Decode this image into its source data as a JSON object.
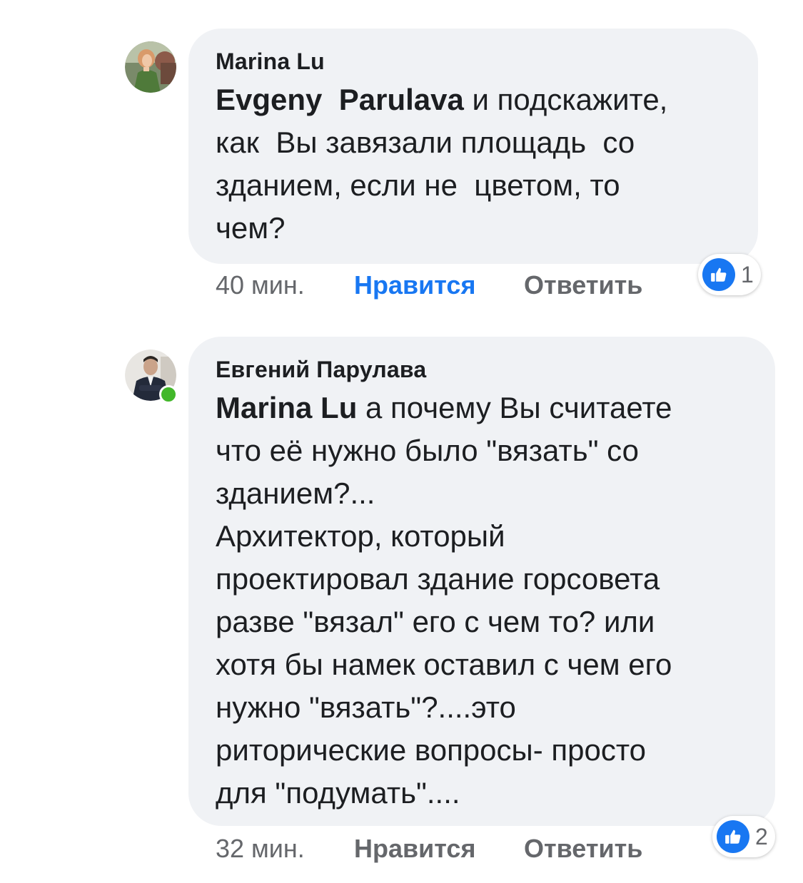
{
  "comments": [
    {
      "author": "Marina Lu",
      "mention": "Evgeny  Parulava",
      "text": " и подскажите,\nкак  Вы завязали площадь  со\nзданием, если не  цветом, то\nчем?",
      "time": "40 мин.",
      "like_label": "Нравится",
      "reply_label": "Ответить",
      "reactions": {
        "icon": "like-icon",
        "count": "1"
      }
    },
    {
      "author": "Евгений Парулава",
      "mention": "Marina Lu",
      "text": " а почему Вы считаете\nчто её нужно было \"вязать\" со\nзданием?...\nАрхитектор, который\nпроектировал здание горсовета\nразве \"вязал\" его с чем то? или\nхотя бы намек оставил с чем его\nнужно \"вязать\"?....это\nриторические вопросы- просто\nдля \"подумать\"....",
      "time": "32 мин.",
      "like_label": "Нравится",
      "reply_label": "Ответить",
      "reactions": {
        "icon": "like-icon",
        "count": "2"
      },
      "online": true
    }
  ],
  "colors": {
    "bubble": "#f0f2f5",
    "accent": "#1877f2",
    "muted": "#65676b",
    "online": "#42b72a"
  }
}
